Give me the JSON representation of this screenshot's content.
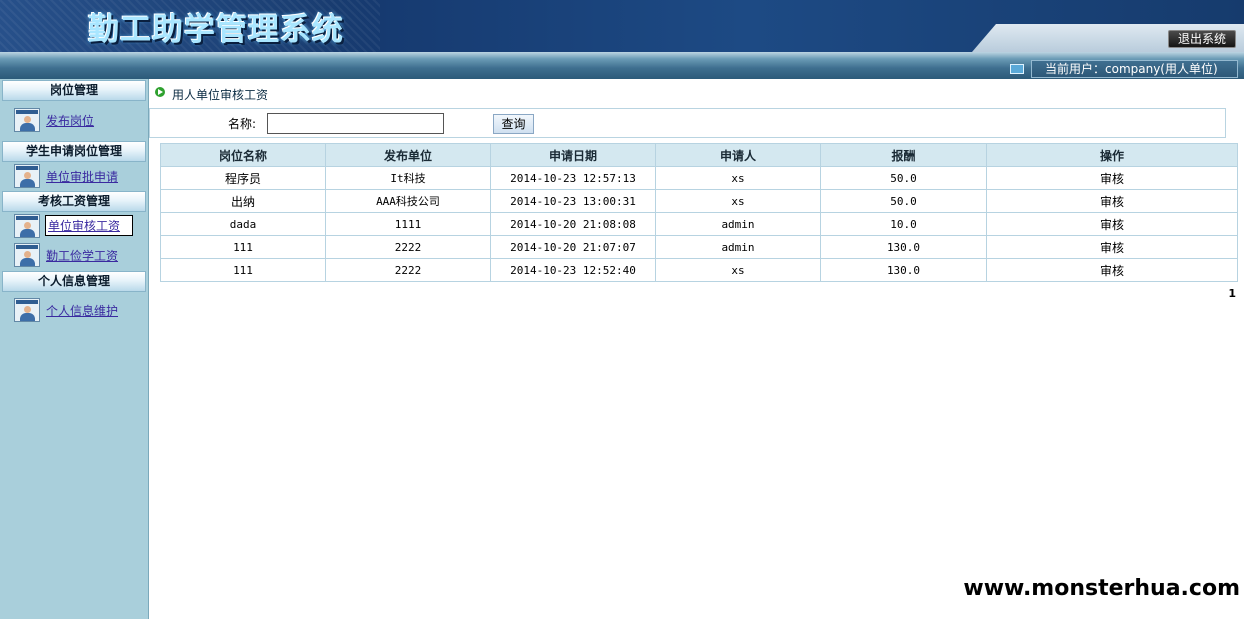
{
  "header": {
    "title": "勤工助学管理系统",
    "exit_label": "退出系统"
  },
  "userbar": {
    "current_user": "当前用户：company(用人单位)"
  },
  "sidebar": {
    "sections": [
      {
        "title": "岗位管理",
        "items": [
          "发布岗位"
        ]
      },
      {
        "title": "学生申请岗位管理",
        "items": [
          "单位审批申请"
        ]
      },
      {
        "title": "考核工资管理",
        "items": [
          "单位审核工资",
          "勤工俭学工资"
        ]
      },
      {
        "title": "个人信息管理",
        "items": [
          "个人信息维护"
        ]
      }
    ],
    "active_item": "单位审核工资"
  },
  "breadcrumb": "用人单位审核工资",
  "search": {
    "label": "名称:",
    "value": "",
    "placeholder": "",
    "button_label": "查询"
  },
  "table": {
    "columns": [
      "岗位名称",
      "发布单位",
      "申请日期",
      "申请人",
      "报酬",
      "操作"
    ],
    "rows": [
      [
        "程序员",
        "It科技",
        "2014-10-23 12:57:13",
        "xs",
        "50.0",
        "审核"
      ],
      [
        "出纳",
        "AAA科技公司",
        "2014-10-23 13:00:31",
        "xs",
        "50.0",
        "审核"
      ],
      [
        "dada",
        "1111",
        "2014-10-20 21:08:08",
        "admin",
        "10.0",
        "审核"
      ],
      [
        "111",
        "2222",
        "2014-10-20 21:07:07",
        "admin",
        "130.0",
        "审核"
      ],
      [
        "111",
        "2222",
        "2014-10-23 12:52:40",
        "xs",
        "130.0",
        "审核"
      ]
    ]
  },
  "pager": {
    "current_page": "1"
  },
  "watermark": "www.monsterhua.com"
}
